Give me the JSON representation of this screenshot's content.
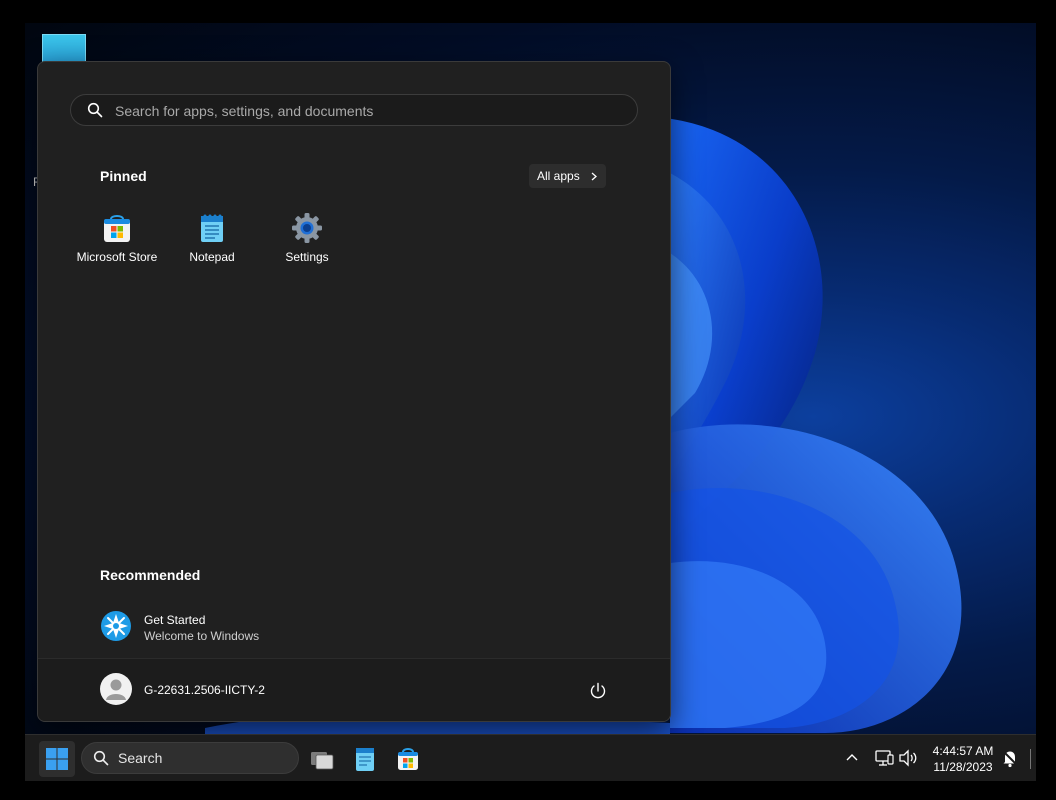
{
  "desktop": {
    "icon_label_fragment": "F"
  },
  "start_menu": {
    "search": {
      "placeholder": "Search for apps, settings, and documents"
    },
    "pinned": {
      "title": "Pinned",
      "all_apps_label": "All apps",
      "apps": [
        {
          "label": "Microsoft Store",
          "icon": "microsoft-store-icon"
        },
        {
          "label": "Notepad",
          "icon": "notepad-icon"
        },
        {
          "label": "Settings",
          "icon": "settings-gear-icon"
        }
      ]
    },
    "recommended": {
      "title": "Recommended",
      "items": [
        {
          "title": "Get Started",
          "subtitle": "Welcome to Windows",
          "icon": "get-started-icon"
        }
      ]
    },
    "user": {
      "name": "G-22631.2506-IICTY-2"
    },
    "power_icon": "power-icon"
  },
  "taskbar": {
    "search_label": "Search",
    "apps": [
      "task-view-icon",
      "notepad-icon",
      "microsoft-store-icon"
    ],
    "tray": {
      "icons": [
        "chevron-up-icon",
        "network-icon",
        "volume-icon",
        "notification-icon"
      ],
      "time": "4:44:57 AM",
      "date": "11/28/2023"
    }
  },
  "colors": {
    "start_bg": "#202020",
    "taskbar_bg": "#1c1c1c",
    "accent_blue": "#0f6cbd",
    "wallpaper_blue": "#0a3fb0"
  }
}
